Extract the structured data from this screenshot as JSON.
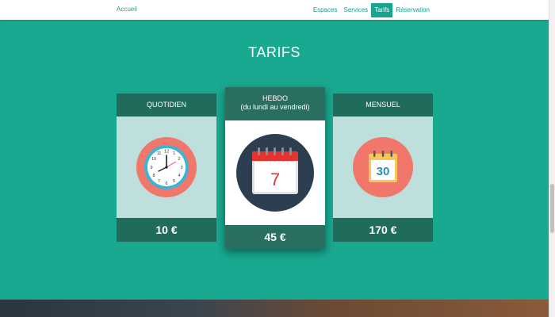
{
  "nav": {
    "brand": "Accueil",
    "links": [
      "Espaces",
      "Services",
      "Tarifs",
      "Réservation"
    ]
  },
  "section": {
    "title": "TARIFS"
  },
  "cards": [
    {
      "title": "QUOTIDIEN",
      "price": "10 €",
      "icon": "clock-icon"
    },
    {
      "title": "HEBDO",
      "subtitle": "(du lundi au vendredi)",
      "price": "45 €",
      "icon": "calendar-icon",
      "calendar_number": "7"
    },
    {
      "title": "MENSUEL",
      "price": "170 €",
      "icon": "calendar-icon",
      "calendar_number": "30"
    }
  ],
  "colors": {
    "section_bg": "#19a890",
    "card_header": "#1f6b5c",
    "accent": "#1a9e8a"
  }
}
